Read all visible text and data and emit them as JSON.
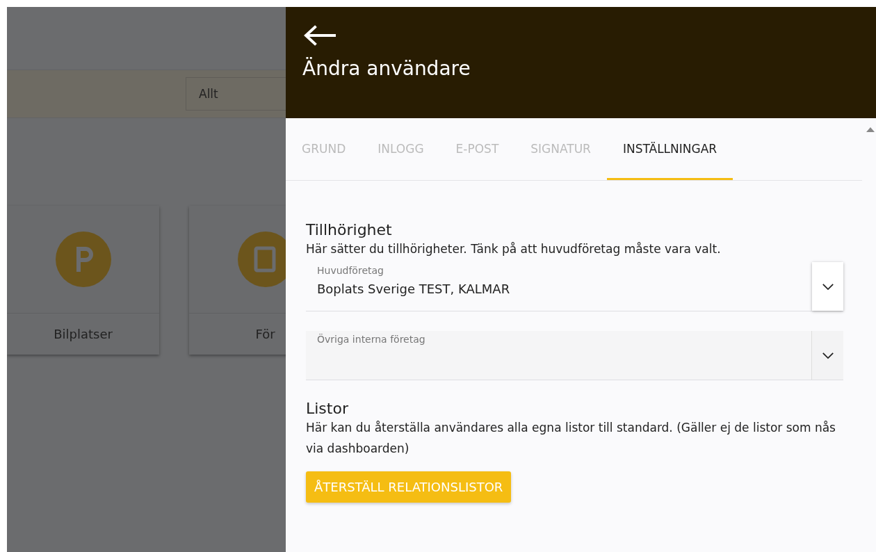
{
  "background": {
    "filter": {
      "value": "Allt"
    },
    "cards": [
      {
        "label": "Bilplatser",
        "kind": "parking"
      },
      {
        "label": "För",
        "kind": "document"
      }
    ]
  },
  "panel": {
    "title": "Ändra användare",
    "tabs": [
      {
        "label": "GRUND",
        "selected": false
      },
      {
        "label": "INLOGG",
        "selected": false
      },
      {
        "label": "E-POST",
        "selected": false
      },
      {
        "label": "SIGNATUR",
        "selected": false
      },
      {
        "label": "INSTÄLLNINGAR",
        "selected": true
      }
    ],
    "sections": [
      {
        "heading": "Tillhörighet",
        "text": "Här sätter du tillhörigheter. Tänk på att huvudföretag måste vara valt.",
        "fields": [
          {
            "label": "Huvudföretag",
            "value": "Boplats Sverige TEST, KALMAR",
            "focused": true
          },
          {
            "label": "Övriga interna företag",
            "focused": false
          }
        ]
      },
      {
        "heading": "Listor",
        "text": "Här kan du återställa användares alla egna listor till standard. (Gäller ej de listor som nås via dashboarden)",
        "button": "ÅTERSTÄLL RELATIONSLISTOR"
      }
    ]
  }
}
